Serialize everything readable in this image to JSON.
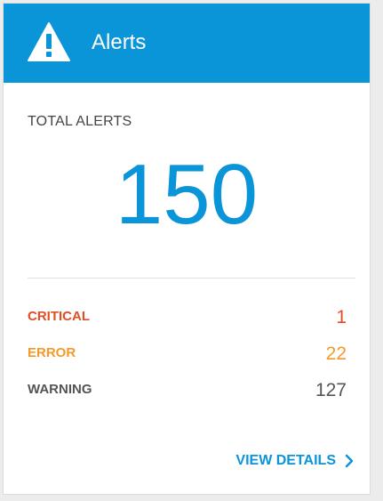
{
  "header": {
    "title": "Alerts",
    "icon": "warning-icon"
  },
  "total": {
    "label": "TOTAL ALERTS",
    "value": "150"
  },
  "breakdown": [
    {
      "label": "CRITICAL",
      "value": "1",
      "color": "#e04e23"
    },
    {
      "label": "ERROR",
      "value": "22",
      "color": "#f39a2a"
    },
    {
      "label": "WARNING",
      "value": "127",
      "color": "#555555"
    }
  ],
  "footer": {
    "link_label": "VIEW DETAILS",
    "link_icon": "chevron-right-icon"
  },
  "colors": {
    "accent": "#0a95d8",
    "critical": "#e04e23",
    "error": "#f39a2a",
    "warning": "#555555"
  }
}
